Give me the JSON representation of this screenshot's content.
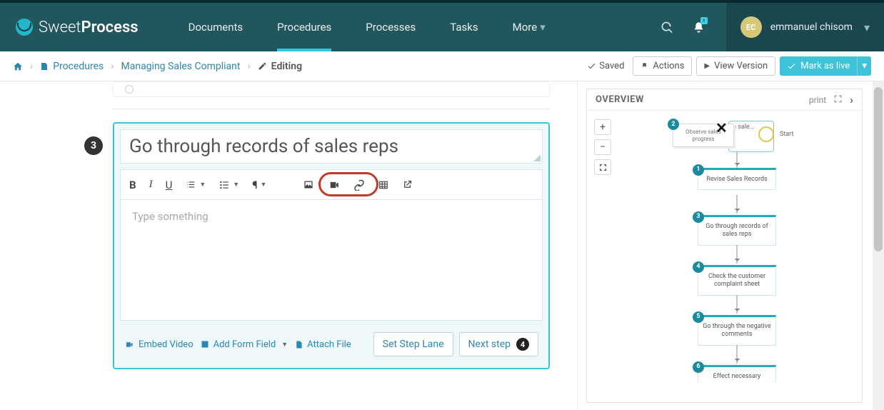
{
  "brand": {
    "thin": "Sweet",
    "bold": "Process"
  },
  "nav": {
    "tabs": [
      "Documents",
      "Procedures",
      "Processes",
      "Tasks",
      "More"
    ],
    "active_index": 1,
    "bell_badge": "1"
  },
  "user": {
    "initials": "EC",
    "name": "emmanuel chisom"
  },
  "breadcrumb": {
    "procedures": "Procedures",
    "item": "Managing Sales Compliant",
    "state": "Editing",
    "saved": "Saved",
    "actions_btn": "Actions",
    "view_btn": "View Version",
    "mark_btn": "Mark as live"
  },
  "step": {
    "number": "3",
    "title": "Go through records of sales reps",
    "placeholder": "Type something",
    "set_lane": "Set Step Lane",
    "next": "Next step",
    "next_badge": "4",
    "embed": "Embed Video",
    "form": "Add Form Field",
    "attach": "Attach File"
  },
  "overview": {
    "title": "OVERVIEW",
    "print": "print",
    "start": "Start",
    "observe": "Observe sales progress",
    "obs_num": "2",
    "side_label": "Is sale...",
    "nodes": [
      {
        "n": "1",
        "t": "Revise Sales Records"
      },
      {
        "n": "3",
        "t": "Go through records of sales reps"
      },
      {
        "n": "4",
        "t": "Check the customer complaint sheet"
      },
      {
        "n": "5",
        "t": "Go through the negative comments"
      },
      {
        "n": "6",
        "t": "Effect necessary"
      }
    ]
  }
}
